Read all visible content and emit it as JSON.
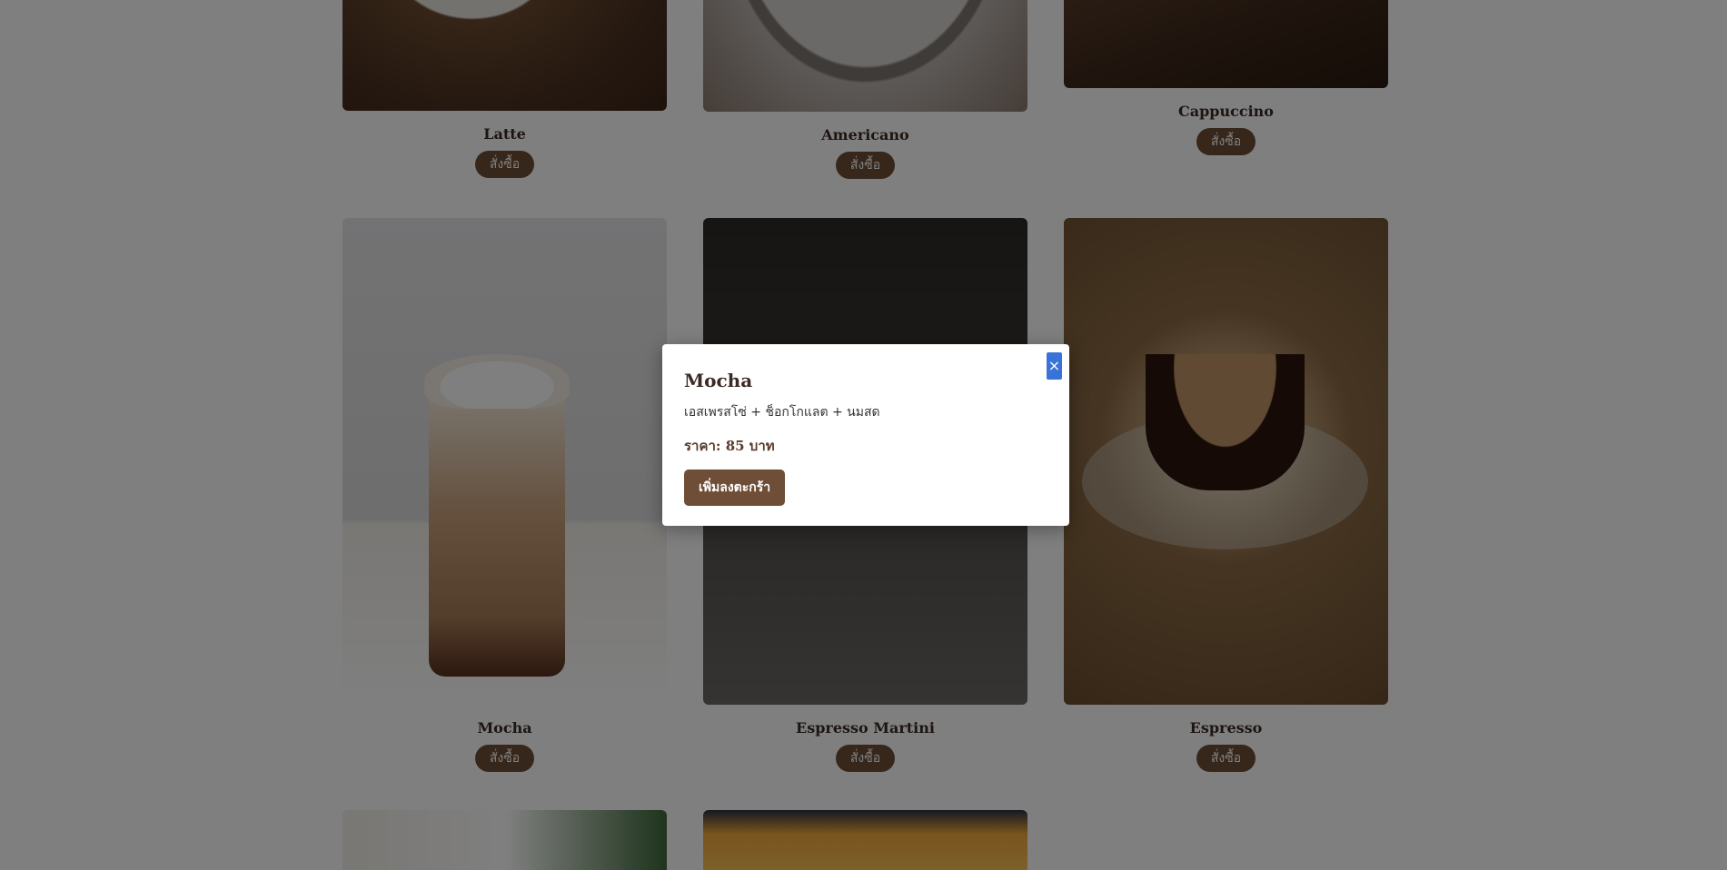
{
  "menu": {
    "order_label": "สั่งซื้อ",
    "items": [
      {
        "name": "Latte"
      },
      {
        "name": "Americano"
      },
      {
        "name": "Cappuccino"
      },
      {
        "name": "Mocha"
      },
      {
        "name": "Espresso Martini"
      },
      {
        "name": "Espresso"
      }
    ]
  },
  "modal": {
    "title": "Mocha",
    "description": "เอสเพรสโซ่ + ช็อกโกแลต + นมสด",
    "price_text": "ราคา: 85 บาท",
    "add_to_cart_label": "เพิ่มลงตะกร้า",
    "close_symbol": "×"
  },
  "colors": {
    "brand_brown": "#6f4e37",
    "close_button_blue": "#3a73d8",
    "overlay": "rgba(0,0,0,0.5)"
  }
}
